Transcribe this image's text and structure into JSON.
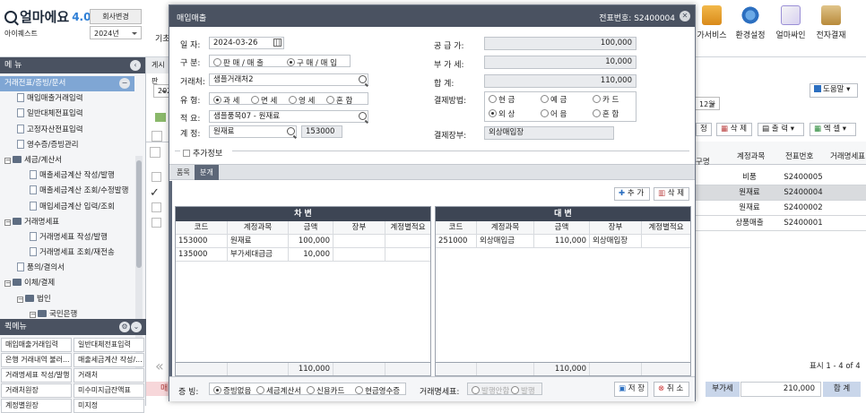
{
  "top": {
    "logo_text": "얼마에요",
    "logo_version": "4.0",
    "company_change_label": "회사변경",
    "company_name": "아이퀘스트",
    "year_select": "2024년",
    "cut_left_label": "기초",
    "tools": [
      {
        "label": "가서비스",
        "icon": "bank-icon"
      },
      {
        "label": "환경설정",
        "icon": "gear-icon"
      },
      {
        "label": "얼마싸인",
        "icon": "signature-icon"
      },
      {
        "label": "전자결재",
        "icon": "approval-icon"
      }
    ]
  },
  "sidebar": {
    "menu_title": "메 뉴",
    "items": [
      {
        "label": "거래전표/증빙/문서",
        "type": "group",
        "selected": true
      },
      {
        "label": "매입매출거래입력",
        "type": "doc",
        "indent": 1
      },
      {
        "label": "일반대체전표입력",
        "type": "doc",
        "indent": 1
      },
      {
        "label": "고정자산전표입력",
        "type": "doc",
        "indent": 1
      },
      {
        "label": "영수증/증빙관리",
        "type": "doc",
        "indent": 1
      },
      {
        "label": "세금/계산서",
        "type": "folder",
        "indent": 0
      },
      {
        "label": "매출세금계산 작성/발행",
        "type": "doc",
        "indent": 2
      },
      {
        "label": "매출세금계산 조회/수정발행",
        "type": "doc",
        "indent": 2
      },
      {
        "label": "매입세금계산 입력/조회",
        "type": "doc",
        "indent": 2
      },
      {
        "label": "거래명세표",
        "type": "folder",
        "indent": 0
      },
      {
        "label": "거래명세표 작성/발행",
        "type": "doc",
        "indent": 2
      },
      {
        "label": "거래명세표 조회/재전송",
        "type": "doc",
        "indent": 2
      },
      {
        "label": "품의/결의서",
        "type": "doc",
        "indent": 1
      },
      {
        "label": "이체/결제",
        "type": "folder",
        "indent": 0
      },
      {
        "label": "법인",
        "type": "folder",
        "indent": 1
      },
      {
        "label": "국민은행",
        "type": "folder",
        "indent": 2
      }
    ],
    "quick_title": "퀵메뉴",
    "quick_items": [
      "매입매출거래입력",
      "일반대체전표입력",
      "은행 거래내역 불러...",
      "매출세금계산 작성/...",
      "거래명세표 작성/발행",
      "거래처",
      "거래처원장",
      "미수미지급잔액표",
      "계정별원장",
      "미지정"
    ]
  },
  "background": {
    "tab_cut": "게시판",
    "year_cut": "202",
    "month_cut": "12월",
    "help_label": "도움말",
    "toolbar_edit_cut": "정",
    "delete_label": "삭 제",
    "print_label": "출 력",
    "excel_label": "엑 셀",
    "columns": [
      "구명",
      "계정과목",
      "전표번호",
      "거래명세표"
    ],
    "rows": [
      {
        "account": "비품",
        "voucher": "S2400005",
        "checked": false,
        "selected": false
      },
      {
        "account": "원재료",
        "voucher": "S2400004",
        "checked": true,
        "selected": true
      },
      {
        "account": "원재료",
        "voucher": "S2400002",
        "checked": false,
        "selected": false
      },
      {
        "account": "상품매출",
        "voucher": "S2400001",
        "checked": false,
        "selected": false
      }
    ],
    "paging": "표시 1 - 4 of 4",
    "vat_label": "부가세",
    "vat_value": "210,000",
    "total_label": "합 계",
    "cut_left_pink": "매"
  },
  "modal": {
    "title": "매입매출",
    "voucher_no": "전표번호: S2400004",
    "fields": {
      "date_label": "일   자:",
      "date_value": "2024-03-26",
      "type_label": "구   분:",
      "type_options": [
        "판 매 / 매 출",
        "구 매 / 매 입"
      ],
      "type_selected": 1,
      "partner_label": "거래처:",
      "partner_value": "샘플거래처2",
      "kind_label": "유   형:",
      "kind_options": [
        "과 세",
        "면 세",
        "영 세",
        "혼 합"
      ],
      "kind_selected": 0,
      "memo_label": "적   요:",
      "memo_value": "샘플품목07 - 원재료",
      "account_label": "계   정:",
      "account_value": "원재료",
      "account_code": "153000",
      "supply_label": "공 급 가:",
      "supply_value": "100,000",
      "vat_label": "부 가 세:",
      "vat_value": "10,000",
      "total_label": "합       계:",
      "total_value": "110,000",
      "pay_label": "결제방법:",
      "pay_options": [
        "현 금",
        "예 금",
        "카 드",
        "외 상",
        "어 음",
        "혼 합"
      ],
      "pay_selected": 3,
      "ledger_label": "결제장부:",
      "ledger_value": "외상매입장",
      "extra_label": "추가정보"
    },
    "tabs": [
      "품목",
      "분개"
    ],
    "active_tab": 1,
    "add_label": "추 가",
    "delete_label": "삭 제",
    "debit": {
      "title": "차 변",
      "columns": [
        "코드",
        "계정과목",
        "금액",
        "장부",
        "계정별적요"
      ],
      "rows": [
        [
          "153000",
          "원재료",
          "100,000",
          "",
          ""
        ],
        [
          "135000",
          "부가세대급금",
          "10,000",
          "",
          ""
        ]
      ],
      "sum": "110,000"
    },
    "credit": {
      "title": "대 변",
      "columns": [
        "코드",
        "계정과목",
        "금액",
        "장부",
        "계정별적요"
      ],
      "rows": [
        [
          "251000",
          "외상매입금",
          "110,000",
          "외상매입장",
          ""
        ]
      ],
      "sum": "110,000"
    },
    "footer": {
      "evidence_label": "증 빙:",
      "evidence_options": [
        "증빙없음",
        "세금계산서",
        "신용카드",
        "현금영수증"
      ],
      "evidence_selected": 0,
      "statement_label": "거래명세표:",
      "statement_options": [
        "발행안함",
        "발행"
      ],
      "save_label": "저 장",
      "cancel_label": "취 소"
    }
  }
}
